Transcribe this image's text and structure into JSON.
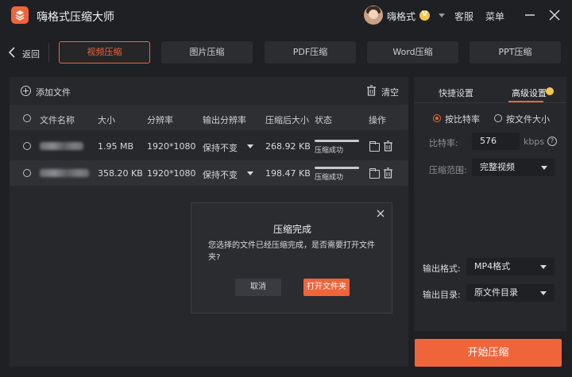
{
  "app": {
    "title": "嗨格式压缩大师",
    "username": "嗨格式",
    "service": "客服",
    "menu": "菜单"
  },
  "nav": {
    "back": "返回",
    "tabs": [
      "视频压缩",
      "图片压缩",
      "PDF压缩",
      "Word压缩",
      "PPT压缩"
    ],
    "active_tab": "视频压缩"
  },
  "file_panel": {
    "add_file": "添加文件",
    "clear": "清空",
    "columns": [
      "文件名称",
      "大小",
      "分辨率",
      "输出分辨率",
      "压缩后大小",
      "状态",
      "操作"
    ],
    "rows": [
      {
        "size": "1.95 MB",
        "resolution": "1920*1080",
        "output_resolution": "保持不变",
        "compressed_size": "268.92 KB",
        "status": "压缩成功",
        "progress": 1.0
      },
      {
        "size": "358.20 KB",
        "resolution": "1920*1080",
        "output_resolution": "保持不变",
        "compressed_size": "198.47 KB",
        "status": "压缩成功",
        "progress": 1.0
      }
    ]
  },
  "dialog": {
    "title": "压缩完成",
    "message": "您选择的文件已经压缩完成，是否需要打开文件夹?",
    "cancel": "取消",
    "open_folder": "打开文件夹"
  },
  "settings": {
    "tabs": [
      "快捷设置",
      "高级设置"
    ],
    "active_tab": "高级设置",
    "mode_bitrate": "按比特率",
    "mode_filesize": "按文件大小",
    "bitrate_label": "比特率:",
    "bitrate_value": "576",
    "bitrate_unit": "kbps",
    "range_label": "压缩范围:",
    "range_value": "完整视频",
    "format_label": "输出格式:",
    "format_value": "MP4格式",
    "dir_label": "输出目录:",
    "dir_value": "原文件目录",
    "start": "开始压缩"
  },
  "colors": {
    "accent": "#f0643a",
    "background": "#1f2023",
    "panel": "#27282c"
  }
}
